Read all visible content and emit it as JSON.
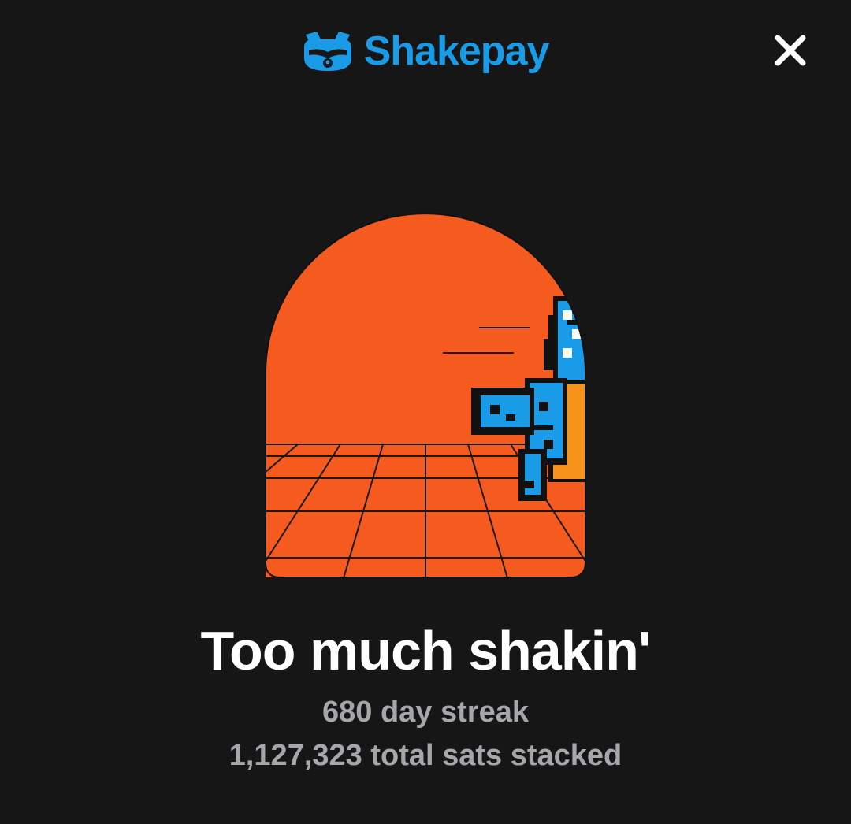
{
  "header": {
    "brand_name": "Shakepay",
    "logo_icon": "raccoon-logo-icon",
    "close_icon": "close-icon"
  },
  "illustration": {
    "description_icon": "pixel-raccoon-running-scene",
    "colors": {
      "arch": "#f55a1f",
      "raccoon_blue": "#1a9be8",
      "backpack": "#f7931a",
      "background": "#161616",
      "brand": "#1a9be8"
    }
  },
  "achievement": {
    "title": "Too much shakin'",
    "streak_text": "680 day streak",
    "sats_text": "1,127,323 total sats stacked"
  }
}
